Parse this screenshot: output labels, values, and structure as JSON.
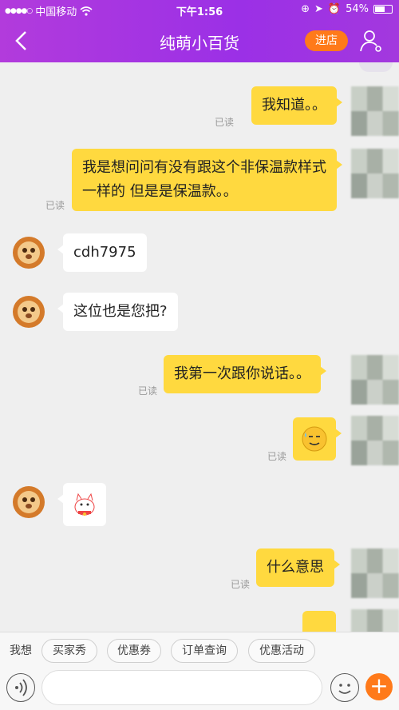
{
  "status_bar": {
    "carrier": "中国移动",
    "time": "下午1:56",
    "battery": "54%"
  },
  "nav": {
    "title": "纯萌小百货",
    "store_button": "进店"
  },
  "messages": [
    {
      "side": "me",
      "text": "我知道。。",
      "read": "已读"
    },
    {
      "side": "me",
      "text": "我是想问问有没有跟这个非保温款样式一样的 但是是保温款。。",
      "read": "已读"
    },
    {
      "side": "other",
      "text": "cdh7975"
    },
    {
      "side": "other",
      "text": "这位也是您把?"
    },
    {
      "side": "me",
      "text": "我第一次跟你说话。。",
      "read": "已读"
    },
    {
      "side": "me",
      "text": "",
      "sticker": "sweat-smile-emoji",
      "read": "已读"
    },
    {
      "side": "other",
      "text": "",
      "sticker": "lucky-cat-sticker"
    },
    {
      "side": "me",
      "text": "什么意思",
      "read": "已读"
    }
  ],
  "quick_bar": {
    "label": "我想",
    "chips": [
      "买家秀",
      "优惠券",
      "订单查询",
      "优惠活动"
    ]
  },
  "input": {
    "placeholder": ""
  },
  "colors": {
    "header_purple": "#9b30e6",
    "accent_orange": "#ff7a1a",
    "my_bubble": "#ffd93f"
  }
}
